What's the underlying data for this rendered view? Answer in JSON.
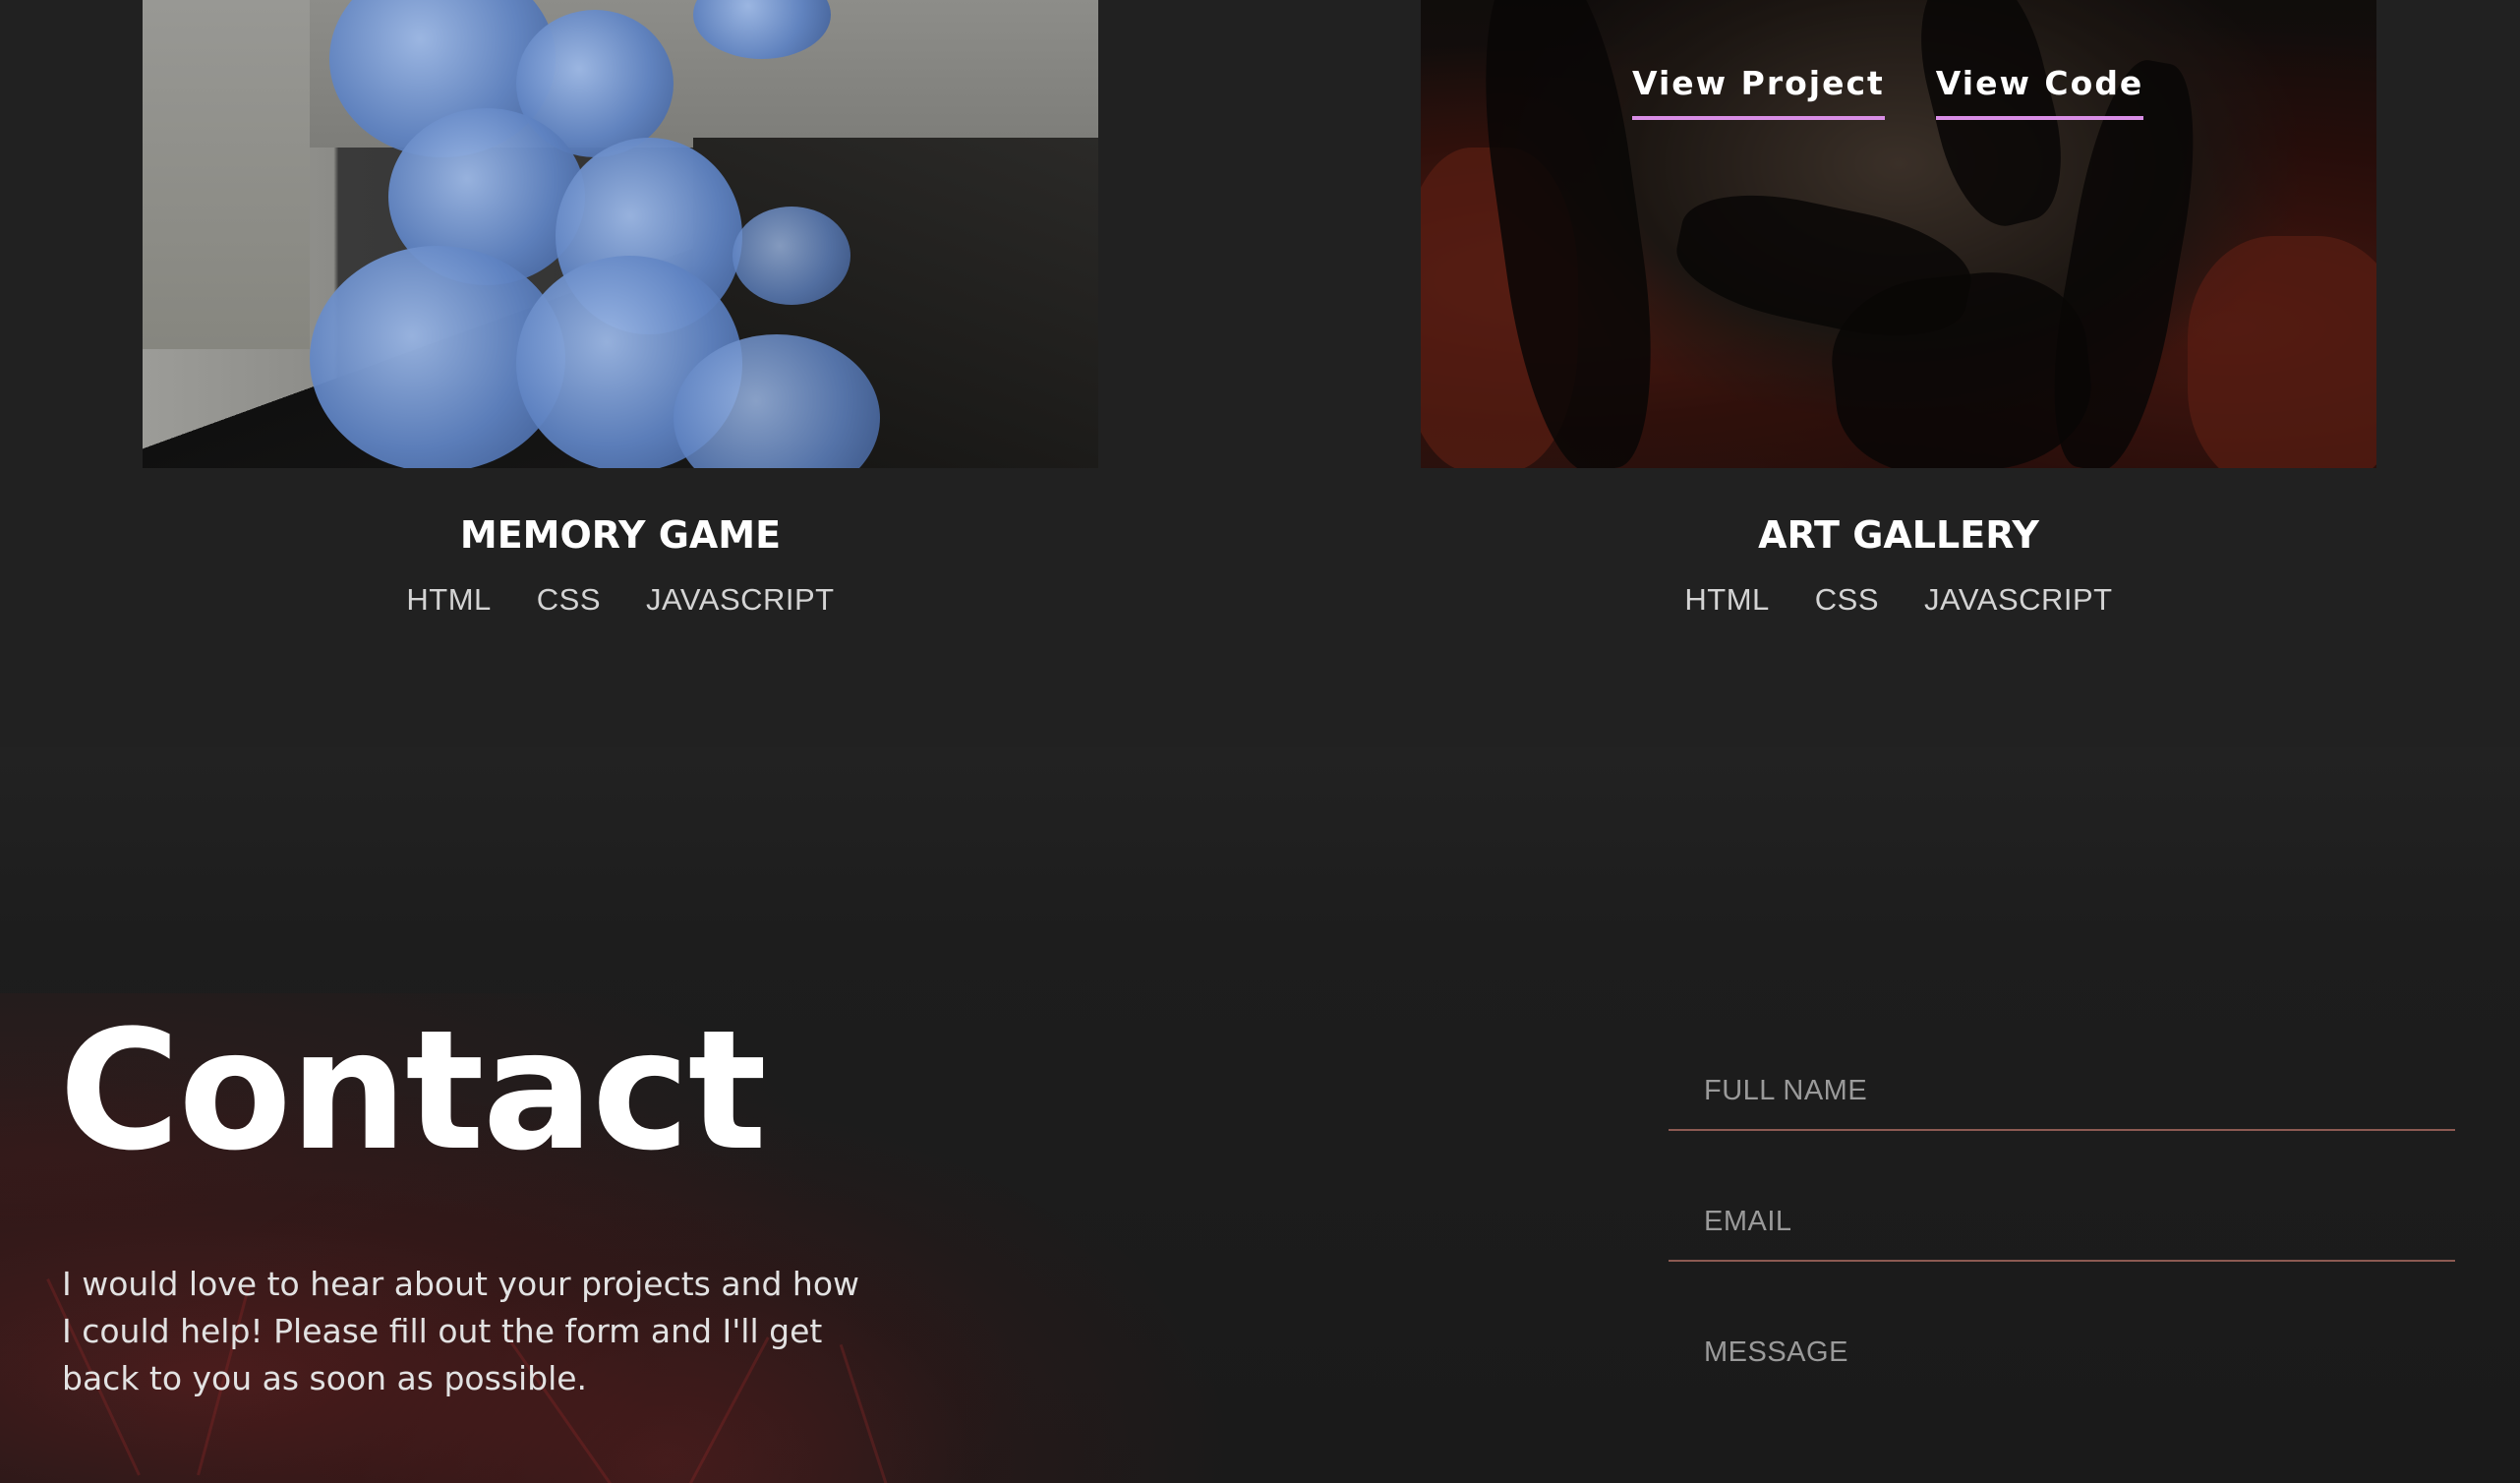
{
  "projects": [
    {
      "title": "MEMORY GAME",
      "tags": [
        "HTML",
        "CSS",
        "JAVASCRIPT"
      ]
    },
    {
      "title": "ART GALLERY",
      "tags": [
        "HTML",
        "CSS",
        "JAVASCRIPT"
      ],
      "links": {
        "view_project": "View Project",
        "view_code": "View Code"
      }
    }
  ],
  "contact": {
    "heading": "Contact",
    "text": "I would love to hear about your projects and how I could help! Please fill out the form and I'll get back to you as soon as possible.",
    "form": {
      "full_name_placeholder": "FULL NAME",
      "email_placeholder": "EMAIL",
      "message_placeholder": "MESSAGE"
    }
  },
  "colors": {
    "background": "#212121",
    "accent_underline": "#d98ee6",
    "field_border": "#8c5a52"
  }
}
